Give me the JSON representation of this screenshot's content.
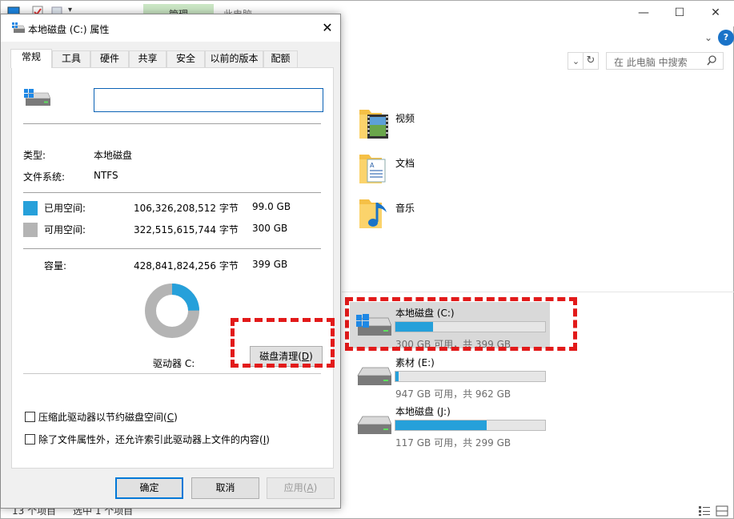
{
  "explorer": {
    "manage_tab": "管理",
    "title": "此电脑",
    "search_placeholder": "在 此电脑 中搜索",
    "folders": [
      {
        "name": "视频"
      },
      {
        "name": "文档"
      },
      {
        "name": "音乐"
      }
    ],
    "drives": [
      {
        "name": "本地磁盘 (C:)",
        "free_text": "300 GB 可用，共 399 GB",
        "used_fraction": 0.25
      },
      {
        "name": "素材 (E:)",
        "free_text": "947 GB 可用，共 962 GB",
        "used_fraction": 0.02
      },
      {
        "name": "本地磁盘 (J:)",
        "free_text": "117 GB 可用，共 299 GB",
        "used_fraction": 0.61
      }
    ],
    "status_count": "13 个项目",
    "status_selected": "选中 1 个项目"
  },
  "dialog": {
    "title": "本地磁盘 (C:) 属性",
    "tabs": [
      "常规",
      "工具",
      "硬件",
      "共享",
      "安全",
      "以前的版本",
      "配额"
    ],
    "name_value": "",
    "type_label": "类型:",
    "type_value": "本地磁盘",
    "fs_label": "文件系统:",
    "fs_value": "NTFS",
    "used_label": "已用空间:",
    "used_bytes": "106,326,208,512 字节",
    "used_gb": "99.0 GB",
    "free_label": "可用空间:",
    "free_bytes": "322,515,615,744 字节",
    "free_gb": "300 GB",
    "capacity_label": "容量:",
    "capacity_bytes": "428,841,824,256 字节",
    "capacity_gb": "399 GB",
    "used_fraction": 0.248,
    "drive_label": "驱动器 C:",
    "cleanup_text": "磁盘清理(",
    "cleanup_key": "D",
    "cleanup_end": ")",
    "compress_text": "压缩此驱动器以节约磁盘空间(",
    "compress_key": "C",
    "compress_end": ")",
    "index_text": "除了文件属性外，还允许索引此驱动器上文件的内容(",
    "index_key": "I",
    "index_end": ")",
    "ok": "确定",
    "cancel": "取消",
    "apply_text": "应用(",
    "apply_key": "A",
    "apply_end": ")",
    "colors": {
      "used": "#26a0da",
      "free": "#b4b4b4",
      "highlight": "#e21a1a"
    }
  }
}
